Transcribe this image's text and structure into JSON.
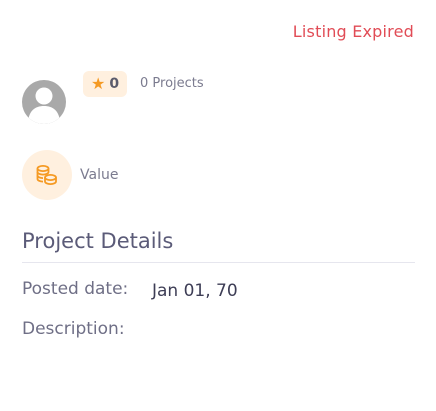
{
  "status": "Listing Expired",
  "rating": {
    "score": "0",
    "icon": "star-icon",
    "accent_color": "#f59a23"
  },
  "projects_count": "0 Projects",
  "value": {
    "label": "Value",
    "icon": "coins-icon"
  },
  "project_details": {
    "title": "Project Details",
    "posted_label": "Posted date:",
    "posted_value": "Jan 01, 70",
    "description_label": "Description:"
  },
  "colors": {
    "status": "#e14c56",
    "badge_bg": "#fff0df",
    "accent": "#f59a23"
  }
}
